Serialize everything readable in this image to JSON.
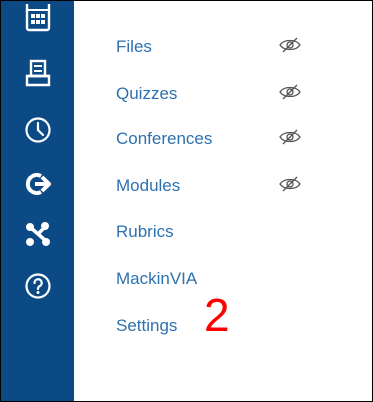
{
  "sidebar": {
    "background": "#0c4a86",
    "icons": [
      {
        "name": "calendar-icon"
      },
      {
        "name": "inbox-icon"
      },
      {
        "name": "history-icon"
      },
      {
        "name": "commons-icon"
      },
      {
        "name": "studio-icon"
      },
      {
        "name": "help-icon"
      }
    ]
  },
  "nav": {
    "link_color": "#2d71b0",
    "items": [
      {
        "label": "Files",
        "hidden_icon": "eye-hidden-icon"
      },
      {
        "label": "Quizzes",
        "hidden_icon": "eye-hidden-icon"
      },
      {
        "label": "Conferences",
        "hidden_icon": "eye-hidden-icon"
      },
      {
        "label": "Modules",
        "hidden_icon": "eye-hidden-icon"
      },
      {
        "label": "Rubrics"
      },
      {
        "label": "MackinVIA"
      },
      {
        "label": "Settings"
      }
    ]
  },
  "annotation": {
    "step_number": "2",
    "color": "#ff0000"
  }
}
